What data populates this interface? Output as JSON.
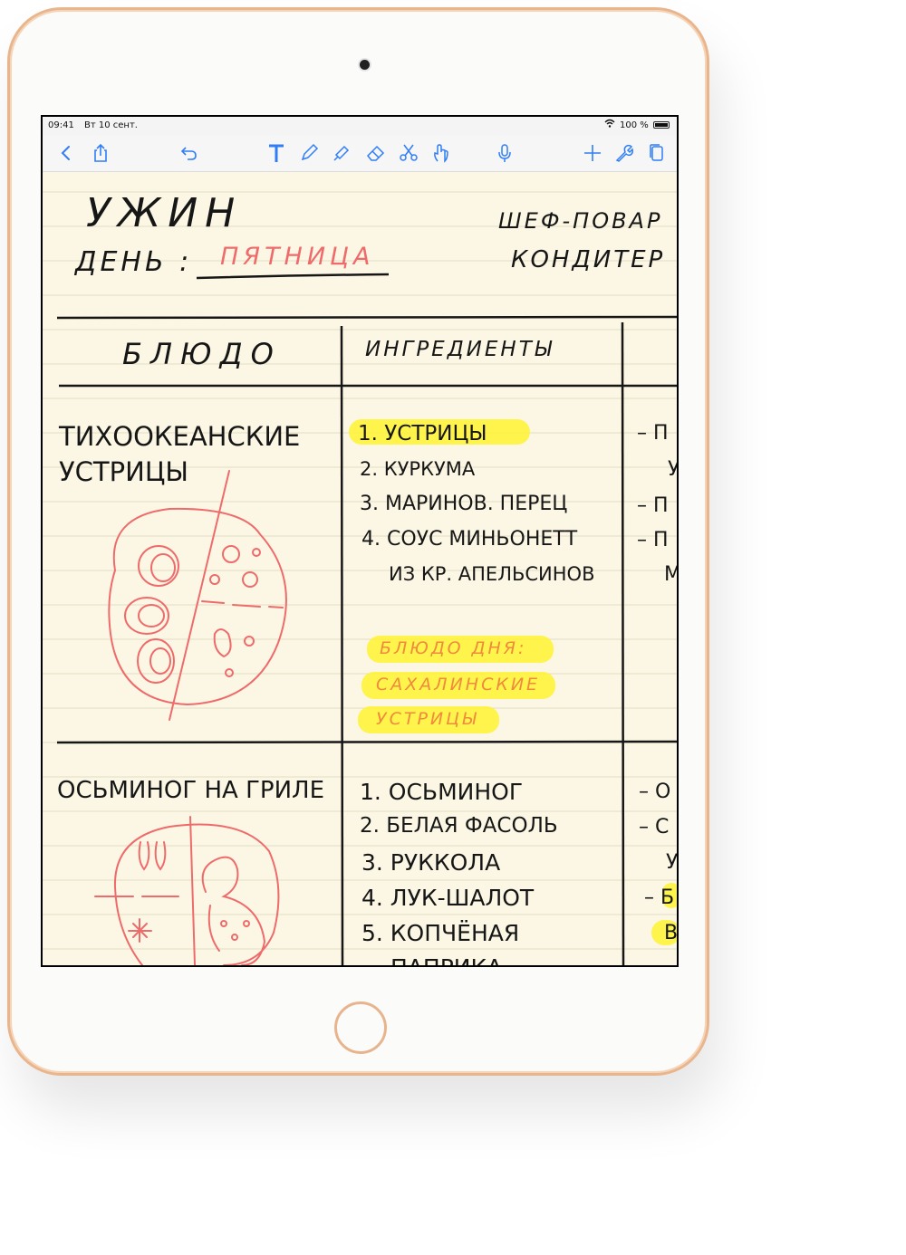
{
  "statusbar": {
    "time": "09:41",
    "date": "Вт 10 сент.",
    "battery": "100 %"
  },
  "toolbar": {
    "icons": [
      "back-icon",
      "share-icon",
      "undo-icon",
      "text-tool-icon",
      "pen-icon",
      "highlighter-icon",
      "eraser-icon",
      "scissors-icon",
      "hand-icon",
      "microphone-icon",
      "add-icon",
      "wrench-icon",
      "pages-icon"
    ],
    "accent": "#2f7ef6"
  },
  "note": {
    "title": "УЖИН",
    "day_label": "ДЕНЬ :",
    "day_value": "ПЯТНИЦА",
    "chef_label": "ШЕФ-ПОВАР",
    "pastry_label": "КОНДИТЕР :",
    "col_dish": "БЛЮДО",
    "col_ingredients": "ИНГРЕДИЕНТЫ",
    "dish1_line1": "ТИХООКЕАНСКИЕ",
    "dish1_line2": "УСТРИЦЫ",
    "dish1_ingredients": [
      "1. УСТРИЦЫ",
      "2. КУРКУМА",
      "3. МАРИНОВ. ПЕРЕЦ",
      "4. СОУС МИНЬОНЕТТ",
      "ИЗ КР. АПЕЛЬСИНОВ"
    ],
    "special_line1": "БЛЮДО ДНЯ:",
    "special_line2": "САХАЛИНСКИЕ",
    "special_line3": "УСТРИЦЫ",
    "dish1_notes": [
      "– П",
      "У",
      "– П",
      "– П",
      "М"
    ],
    "dish2_title": "ОСЬМИНОГ НА ГРИЛЕ",
    "dish2_ingredients": [
      "1. ОСЬМИНОГ",
      "2. БЕЛАЯ ФАСОЛЬ",
      "3. РУККОЛА",
      "4. ЛУК-ШАЛОТ",
      "5. КОПЧЁНАЯ",
      "ПАПРИКА"
    ],
    "dish2_notes": [
      "– О",
      "– С",
      "У",
      "– Б",
      "В"
    ],
    "ink_black": "#161616",
    "ink_red": "#ef6b6b",
    "highlight": "#fff33a",
    "paper": "#fbf7e4"
  }
}
